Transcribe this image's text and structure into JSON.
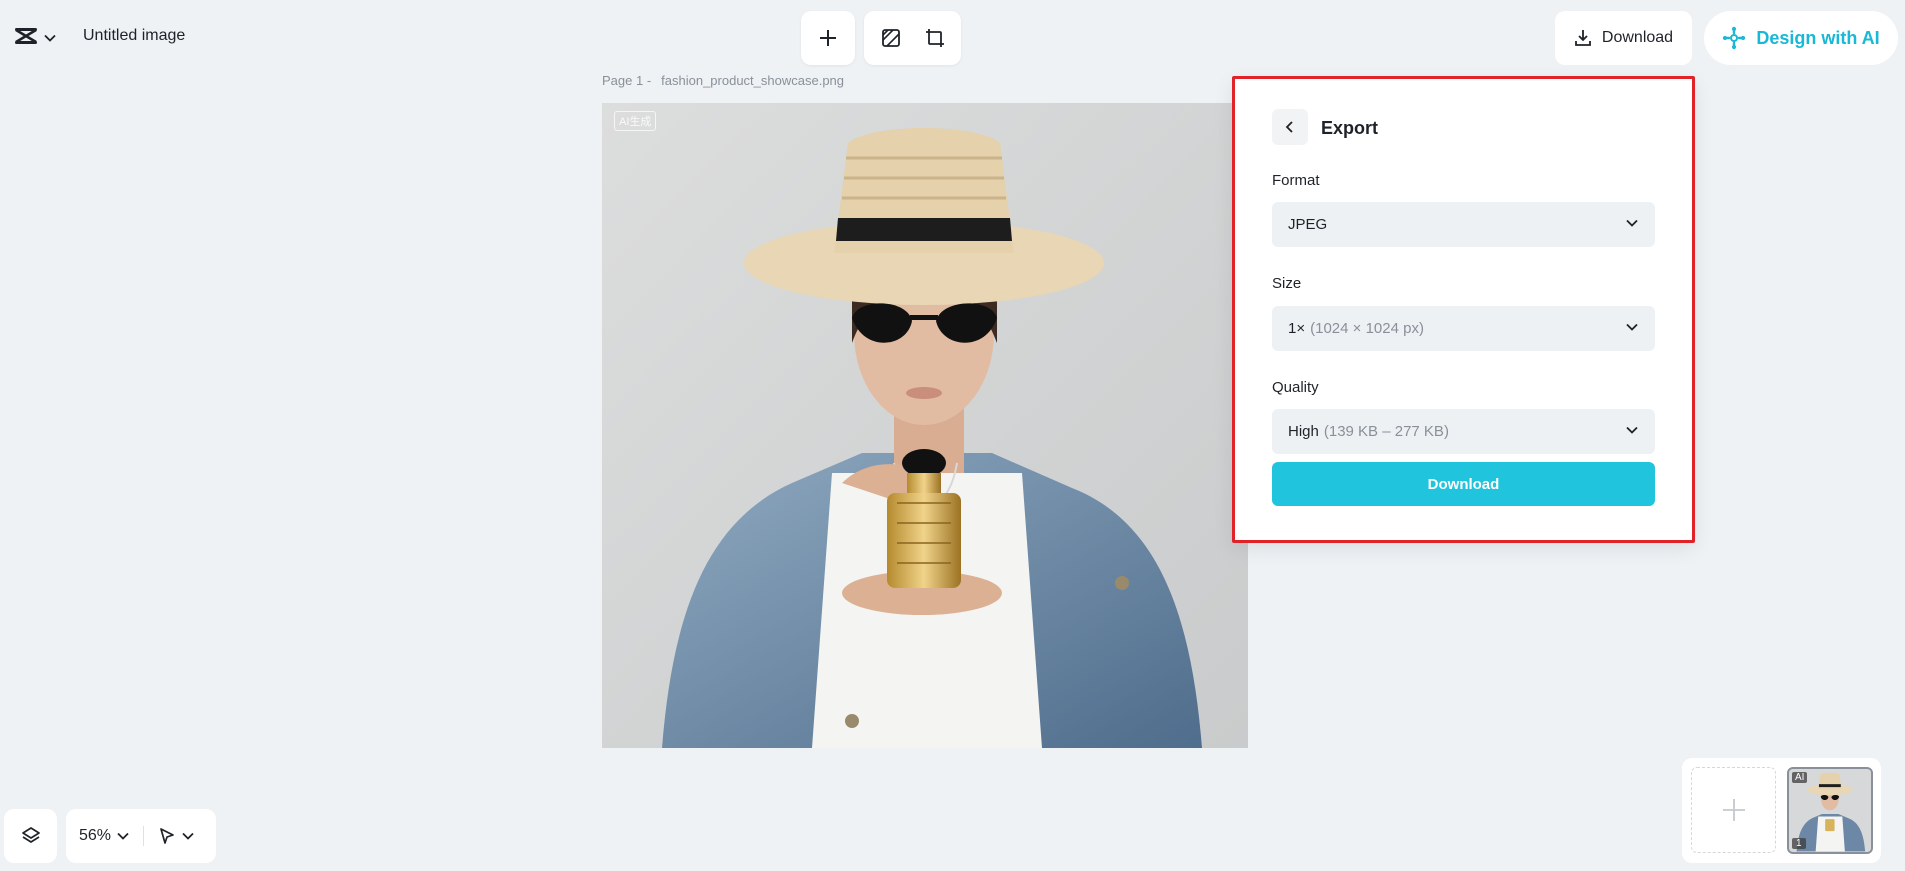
{
  "header": {
    "doc_title": "Untitled image",
    "download_label": "Download",
    "design_ai_label": "Design with AI"
  },
  "canvas": {
    "page_label": "Page 1 -",
    "file_name": "fashion_product_showcase.png",
    "watermark": "AI生成"
  },
  "export": {
    "title": "Export",
    "format_label": "Format",
    "format_value": "JPEG",
    "size_label": "Size",
    "size_value": "1×",
    "size_detail": "(1024 × 1024 px)",
    "quality_label": "Quality",
    "quality_value": "High",
    "quality_detail": "(139 KB – 277 KB)",
    "download_label": "Download"
  },
  "footer": {
    "zoom": "56%"
  },
  "pages": {
    "thumb_badge": "AI",
    "thumb_number": "1"
  },
  "colors": {
    "accent": "#20c4dc",
    "highlight_border": "#e12228",
    "background": "#eef2f5"
  }
}
